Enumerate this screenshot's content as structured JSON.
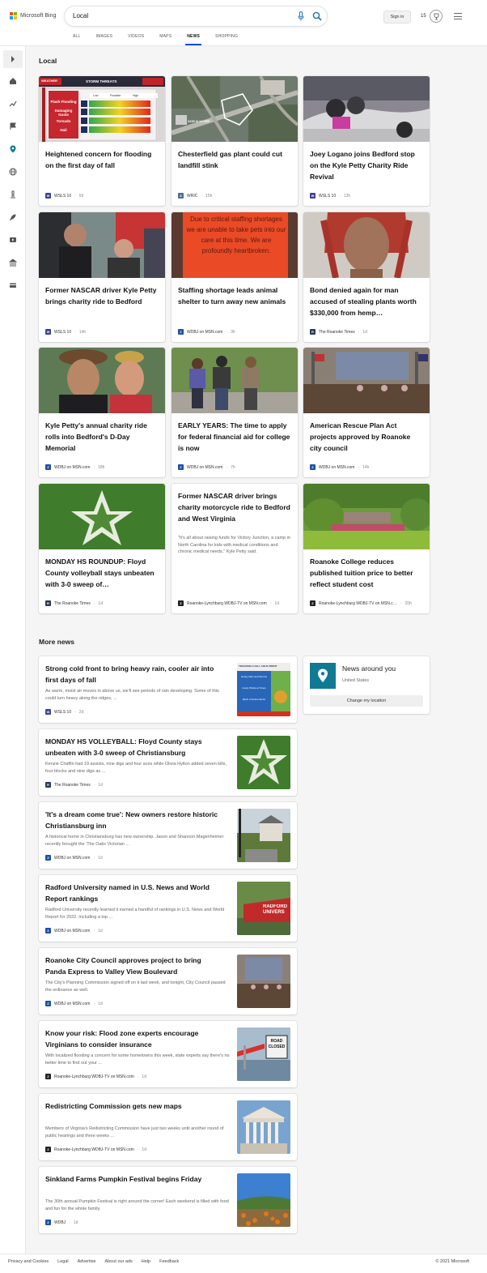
{
  "header": {
    "logo_text": "Microsoft Bing",
    "search_value": "Local",
    "signin_label": "Sign in",
    "rewards_count": "15"
  },
  "tabs": [
    "ALL",
    "IMAGES",
    "VIDEOS",
    "MAPS",
    "NEWS",
    "SHOPPING"
  ],
  "active_tab": "NEWS",
  "local": {
    "title": "Local",
    "cards": [
      {
        "title": "Heightened concern for flooding on the first day of fall",
        "source": "WSLS 10",
        "time": "5h"
      },
      {
        "title": "Chesterfield gas plant could cut landfill stink",
        "source": "WRIC",
        "time": "15h"
      },
      {
        "title": "Joey Logano joins Bedford stop on the Kyle Petty Charity Ride Revival",
        "source": "WSLS 10",
        "time": "13h"
      },
      {
        "title": "Former NASCAR driver Kyle Petty brings charity ride to Bedford",
        "source": "WSLS 10",
        "time": "14h"
      },
      {
        "title": "Staffing shortage leads animal shelter to turn away new animals",
        "source": "WDBJ on MSN.com",
        "time": "3h"
      },
      {
        "title": "Bond denied again for man accused of stealing plants worth $330,000 from hemp…",
        "source": "The Roanoke Times",
        "time": "1d"
      },
      {
        "title": "Kyle Petty's annual charity ride rolls into Bedford's D-Day Memorial",
        "source": "WDBJ on MSN.com",
        "time": "18h"
      },
      {
        "title": "EARLY YEARS: The time to apply for federal financial aid for college is now",
        "source": "WDBJ on MSN.com",
        "time": "7h"
      },
      {
        "title": "American Rescue Plan Act projects approved by Roanoke city council",
        "source": "WDBJ on MSN.com",
        "time": "14h"
      },
      {
        "title": "MONDAY HS ROUNDUP: Floyd County volleyball stays unbeaten with 3-0 sweep of…",
        "source": "The Roanoke Times",
        "time": "1d"
      },
      {
        "title": "Former NASCAR driver brings charity motorcycle ride to Bedford and West Virginia",
        "snippet": "\"It's all about raising funds for Victory Junction, a camp in North Carolina for kids with medical conditions and chronic medical needs,\" Kyle Petty said.",
        "source": "Roanoke-Lynchburg WDBJ-TV on MSN.com",
        "time": "1d"
      },
      {
        "title": "Roanoke College reduces published tuition price to better reflect student cost",
        "source": "Roanoke-Lynchburg WDBJ-TV on MSN.c…",
        "time": "20h"
      }
    ],
    "image_captions": {
      "weather_header": "STORM THREATS",
      "weather_rows": [
        "Flash Flooding",
        "Damaging Gusts",
        "Tornado",
        "Hail"
      ],
      "weather_cols": [
        "Low",
        "Possible",
        "High"
      ],
      "weather_corner": "WEATHER",
      "map_label": "3153 N 14 HEF",
      "sign_text": "Due to critical staffing shortages we are unable to take pets into our care at this time. We are profoundly heartbroken."
    }
  },
  "more_news": {
    "title": "More news",
    "items": [
      {
        "title": "Strong cold front to bring heavy rain, cooler air into first days of fall",
        "snippet": "As warm, moist air moves in above us, we'll see periods of rain developing. Some of this could turn heavy along the ridges, ...",
        "source": "WSLS 10",
        "time": "2d"
      },
      {
        "title": "MONDAY HS VOLLEYBALL: Floyd County stays unbeaten with 3-0 sweep of Christiansburg",
        "snippet": "Kenzie Chaffin had 19 assists, nine digs and four aces while Olivia Hylton added seven kills, four blocks and nine digs as ...",
        "source": "The Roanoke Times",
        "time": "1d"
      },
      {
        "title": "'It's a dream come true': New owners restore historic Christiansburg inn",
        "snippet": "A historical home in Christiansburg has new ownership. Jason and Shannon Magenheimer recently brought the 'The Oaks Victorian ...",
        "source": "WDBJ on MSN.com",
        "time": "1d"
      },
      {
        "title": "Radford University named in U.S. News and World Report rankings",
        "snippet": "Radford University recently learned it earned a handful of rankings in U.S. News and World Report for 2022. Including a top ...",
        "source": "WDBJ on MSN.com",
        "time": "1d"
      },
      {
        "title": "Roanoke City Council approves project to bring Panda Express to Valley View Boulevard",
        "snippet": "The City's Planning Commission signed off on it last week, and tonight, City Council passed the ordinance as well.",
        "source": "WDBJ on MSN.com",
        "time": "1d"
      },
      {
        "title": "Know your risk: Flood zone experts encourage Virginians to consider insurance",
        "snippet": "With localized flooding a concern for some hometowns this week, state experts say there's no better time to find out your ...",
        "source": "Roanoke-Lynchburg WDBJ-TV on MSN.com",
        "time": "1d"
      },
      {
        "title": "Redistricting Commission gets new maps",
        "snippet": "Members of Virginia's Redistricting Commission have just two weeks until another round of public hearings and three weeks ...",
        "source": "Roanoke-Lynchburg WDBJ-TV on MSN.com",
        "time": "1d"
      },
      {
        "title": "Sinkland Farms Pumpkin Festival begins Friday",
        "snippet": "The 30th annual Pumpkin Festival is right around the corner! Each weekend is filled with food and fun for the whole family.",
        "source": "WDBJ",
        "time": "1d"
      }
    ],
    "thumb_captions": {
      "front_header": "TRACKING A FALL COLD FRONT",
      "front_boxes": [
        "Heavy Rain and Storms",
        "Gusty Winds at Times",
        "Much of Autumnal Air"
      ],
      "radford_sign": "RADFORD UNIVERS",
      "road_sign": "ROAD CLOSED"
    }
  },
  "around": {
    "title": "News around you",
    "location": "United States",
    "button": "Change my location"
  },
  "footer": {
    "links": [
      "Privacy and Cookies",
      "Legal",
      "Advertise",
      "About our ads",
      "Help",
      "Feedback"
    ],
    "copyright": "© 2021 Microsoft"
  },
  "colors": {
    "accent": "#174ae4",
    "pin": "#0e7a94",
    "wsls": "#3c3f9c",
    "wdbj": "#1d4fa6"
  }
}
